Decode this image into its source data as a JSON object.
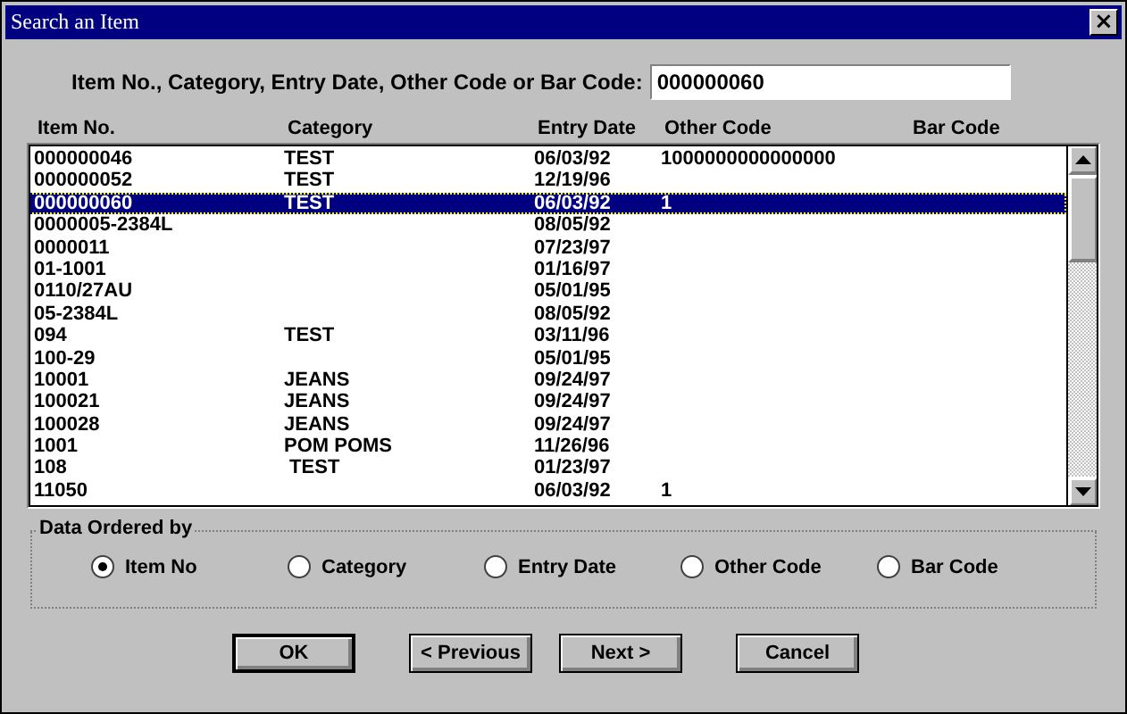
{
  "window": {
    "title": "Search an Item",
    "close": "×"
  },
  "search": {
    "label": "Item No., Category, Entry Date, Other Code or Bar Code:",
    "value": "000000060"
  },
  "table": {
    "columns": [
      "Item No.",
      "Category",
      "Entry Date",
      "Other Code",
      "Bar Code"
    ],
    "rows": [
      {
        "cells": [
          "000000046",
          "TEST",
          "06/03/92",
          "1000000000000000",
          ""
        ],
        "selected": false
      },
      {
        "cells": [
          "000000052",
          "TEST",
          "12/19/96",
          "",
          ""
        ],
        "selected": false
      },
      {
        "cells": [
          "000000060",
          "TEST",
          "06/03/92",
          "1",
          ""
        ],
        "selected": true
      },
      {
        "cells": [
          "0000005-2384L",
          "",
          "08/05/92",
          "",
          ""
        ],
        "selected": false
      },
      {
        "cells": [
          "0000011",
          "",
          "07/23/97",
          "",
          ""
        ],
        "selected": false
      },
      {
        "cells": [
          "01-1001",
          "",
          "01/16/97",
          "",
          ""
        ],
        "selected": false
      },
      {
        "cells": [
          "0110/27AU",
          "",
          "05/01/95",
          "",
          ""
        ],
        "selected": false
      },
      {
        "cells": [
          "05-2384L",
          "",
          "08/05/92",
          "",
          ""
        ],
        "selected": false
      },
      {
        "cells": [
          "094",
          "TEST",
          "03/11/96",
          "",
          ""
        ],
        "selected": false
      },
      {
        "cells": [
          "100-29",
          "",
          "05/01/95",
          "",
          ""
        ],
        "selected": false
      },
      {
        "cells": [
          "10001",
          "JEANS",
          "09/24/97",
          "",
          ""
        ],
        "selected": false
      },
      {
        "cells": [
          "100021",
          "JEANS",
          "09/24/97",
          "",
          ""
        ],
        "selected": false
      },
      {
        "cells": [
          "100028",
          "JEANS",
          "09/24/97",
          "",
          ""
        ],
        "selected": false
      },
      {
        "cells": [
          "1001",
          "POM POMS",
          "11/26/96",
          "",
          ""
        ],
        "selected": false
      },
      {
        "cells": [
          "108",
          " TEST",
          "01/23/97",
          "",
          ""
        ],
        "selected": false
      },
      {
        "cells": [
          "11050",
          "",
          "06/03/92",
          "1",
          ""
        ],
        "selected": false
      }
    ]
  },
  "order": {
    "title": "Data Ordered by",
    "options": [
      {
        "label": "Item No",
        "selected": true
      },
      {
        "label": "Category",
        "selected": false
      },
      {
        "label": "Entry Date",
        "selected": false
      },
      {
        "label": "Other Code",
        "selected": false
      },
      {
        "label": "Bar Code",
        "selected": false
      }
    ]
  },
  "buttons": [
    {
      "label": "OK",
      "default": true
    },
    {
      "label": "< Previous",
      "default": false
    },
    {
      "label": "Next >",
      "default": false
    },
    {
      "label": "Cancel",
      "default": false
    }
  ]
}
